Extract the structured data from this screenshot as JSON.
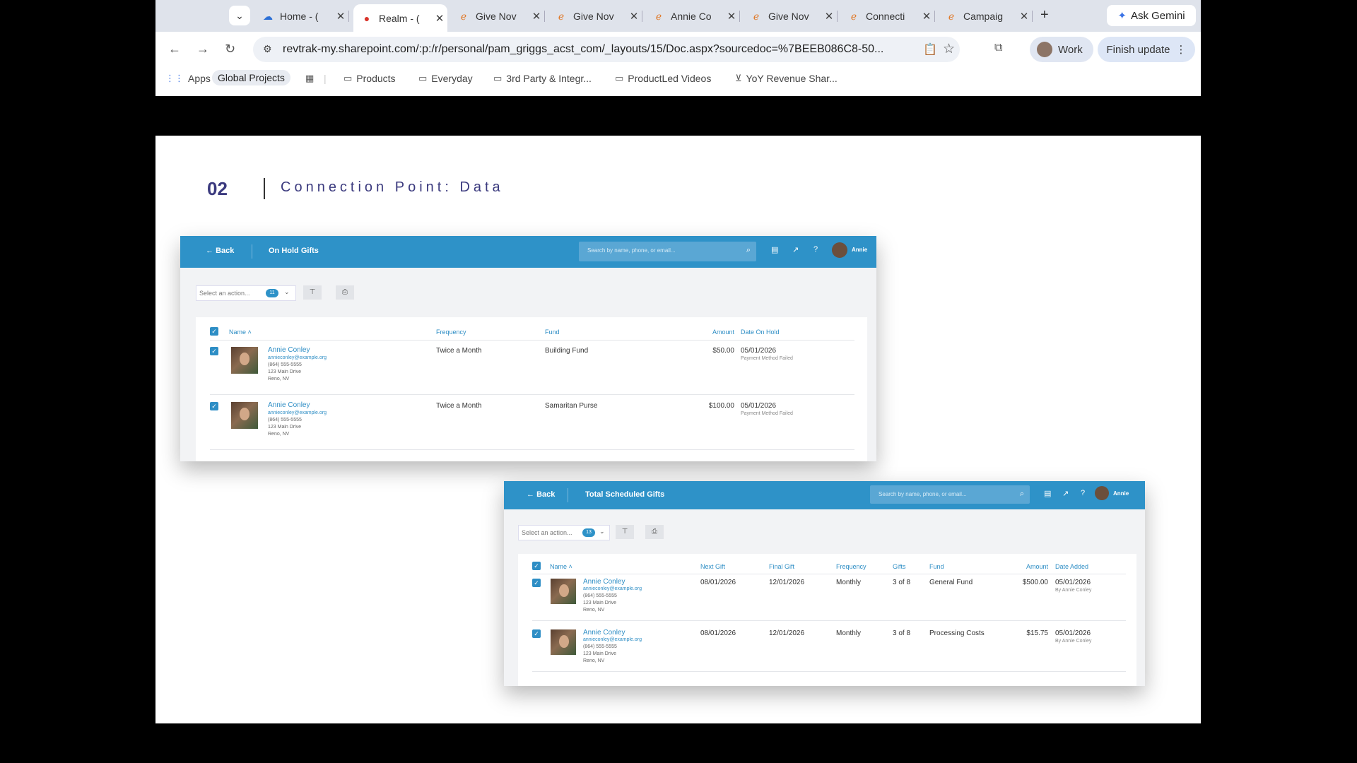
{
  "browser": {
    "tabs": [
      {
        "title": "Home - (",
        "icon": "cloud-icon",
        "active": false
      },
      {
        "title": "Realm - (",
        "icon": "realm-icon",
        "active": true
      },
      {
        "title": "Give Nov",
        "icon": "edge-icon",
        "active": false
      },
      {
        "title": "Give Nov",
        "icon": "edge-icon",
        "active": false
      },
      {
        "title": "Annie Co",
        "icon": "edge-icon",
        "active": false
      },
      {
        "title": "Give Nov",
        "icon": "edge-icon",
        "active": false
      },
      {
        "title": "Connecti",
        "icon": "edge-icon",
        "active": false
      },
      {
        "title": "Campaig",
        "icon": "edge-icon",
        "active": false
      }
    ],
    "ask_gemini": "Ask Gemini",
    "url": "revtrak-my.sharepoint.com/:p:/r/personal/pam_griggs_acst_com/_layouts/15/Doc.aspx?sourcedoc=%7BEEB086C8-50...",
    "profile_label": "Work",
    "finish_update": "Finish update",
    "bookmarks": {
      "apps": "Apps",
      "global_projects": "Global Projects",
      "items": [
        "Products",
        "Everyday",
        "3rd Party & Integr...",
        "ProductLed Videos",
        "YoY Revenue Shar..."
      ]
    }
  },
  "slide": {
    "number": "02",
    "title": "Connection Point: Data"
  },
  "on_hold": {
    "back": "Back",
    "page_title": "On Hold Gifts",
    "search_placeholder": "Search by name, phone, or email...",
    "user": "Annie",
    "select_action": "Select an action...",
    "count": "11",
    "headers": {
      "name": "Name",
      "frequency": "Frequency",
      "fund": "Fund",
      "amount": "Amount",
      "date_on_hold": "Date On Hold"
    },
    "rows": [
      {
        "name": "Annie Conley",
        "email": "annieconley@example.org",
        "phone": "(864) 555-5555",
        "street": "123 Main Drive",
        "city": "Reno, NV",
        "frequency": "Twice a Month",
        "fund": "Building Fund",
        "amount": "$50.00",
        "date": "05/01/2026",
        "note": "Payment Method Failed"
      },
      {
        "name": "Annie Conley",
        "email": "annieconley@example.org",
        "phone": "(864) 555-5555",
        "street": "123 Main Drive",
        "city": "Reno, NV",
        "frequency": "Twice a Month",
        "fund": "Samaritan Purse",
        "amount": "$100.00",
        "date": "05/01/2026",
        "note": "Payment Method Failed"
      }
    ]
  },
  "scheduled": {
    "back": "Back",
    "page_title": "Total Scheduled Gifts",
    "search_placeholder": "Search by name, phone, or email...",
    "user": "Annie",
    "select_action": "Select an action...",
    "count": "13",
    "headers": {
      "name": "Name",
      "next_gift": "Next Gift",
      "final_gift": "Final Gift",
      "frequency": "Frequency",
      "gifts": "Gifts",
      "fund": "Fund",
      "amount": "Amount",
      "date_added": "Date Added"
    },
    "rows": [
      {
        "name": "Annie Conley",
        "email": "annieconley@example.org",
        "phone": "(864) 555-5555",
        "street": "123 Main Drive",
        "city": "Reno, NV",
        "next_gift": "08/01/2026",
        "final_gift": "12/01/2026",
        "frequency": "Monthly",
        "gifts": "3 of 8",
        "fund": "General Fund",
        "amount": "$500.00",
        "date_added": "05/01/2026",
        "added_by": "By Annie Conley"
      },
      {
        "name": "Annie Conley",
        "email": "annieconley@example.org",
        "phone": "(864) 555-5555",
        "street": "123 Main Drive",
        "city": "Reno, NV",
        "next_gift": "08/01/2026",
        "final_gift": "12/01/2026",
        "frequency": "Monthly",
        "gifts": "3 of 8",
        "fund": "Processing Costs",
        "amount": "$15.75",
        "date_added": "05/01/2026",
        "added_by": "By Annie Conley"
      }
    ]
  }
}
